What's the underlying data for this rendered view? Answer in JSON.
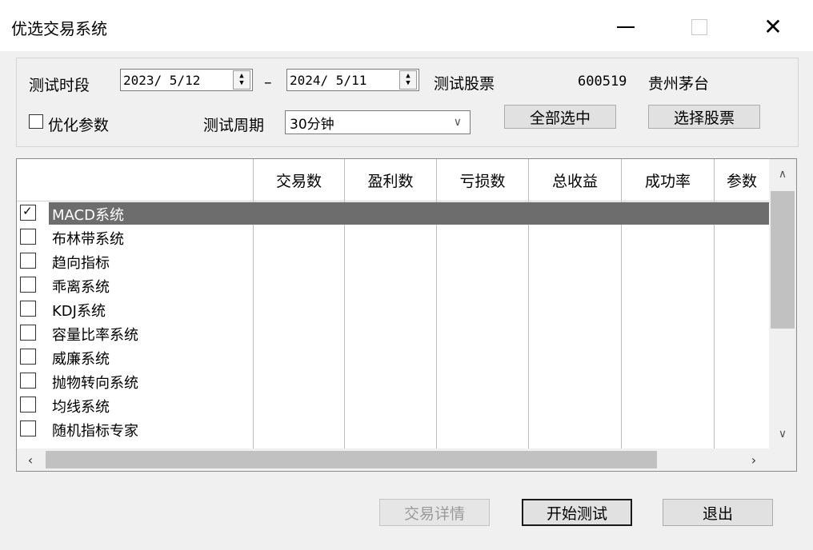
{
  "window": {
    "title": "优选交易系统",
    "minimize": "—",
    "maximize": "□",
    "close": "✕"
  },
  "params": {
    "period_label": "测试时段",
    "start_date": "2023/ 5/12",
    "dash": "–",
    "end_date": "2024/ 5/11",
    "stock_label": "测试股票",
    "stock_code": "600519",
    "stock_name": "贵州茅台",
    "optimize_label": "优化参数",
    "cycle_label": "测试周期",
    "cycle_value": "30分钟",
    "select_all_label": "全部选中",
    "choose_stock_label": "选择股票"
  },
  "table": {
    "columns": [
      "交易数",
      "盈利数",
      "亏损数",
      "总收益",
      "成功率",
      "参数"
    ],
    "rows": [
      {
        "name": "MACD系统",
        "checked": true,
        "selected": true
      },
      {
        "name": "布林带系统",
        "checked": false,
        "selected": false
      },
      {
        "name": "趋向指标",
        "checked": false,
        "selected": false
      },
      {
        "name": "乖离系统",
        "checked": false,
        "selected": false
      },
      {
        "name": "KDJ系统",
        "checked": false,
        "selected": false
      },
      {
        "name": "容量比率系统",
        "checked": false,
        "selected": false
      },
      {
        "name": "威廉系统",
        "checked": false,
        "selected": false
      },
      {
        "name": "抛物转向系统",
        "checked": false,
        "selected": false
      },
      {
        "name": "均线系统",
        "checked": false,
        "selected": false
      },
      {
        "name": "随机指标专家",
        "checked": false,
        "selected": false
      }
    ]
  },
  "footer": {
    "trade_detail_label": "交易详情",
    "start_test_label": "开始测试",
    "exit_label": "退出"
  }
}
